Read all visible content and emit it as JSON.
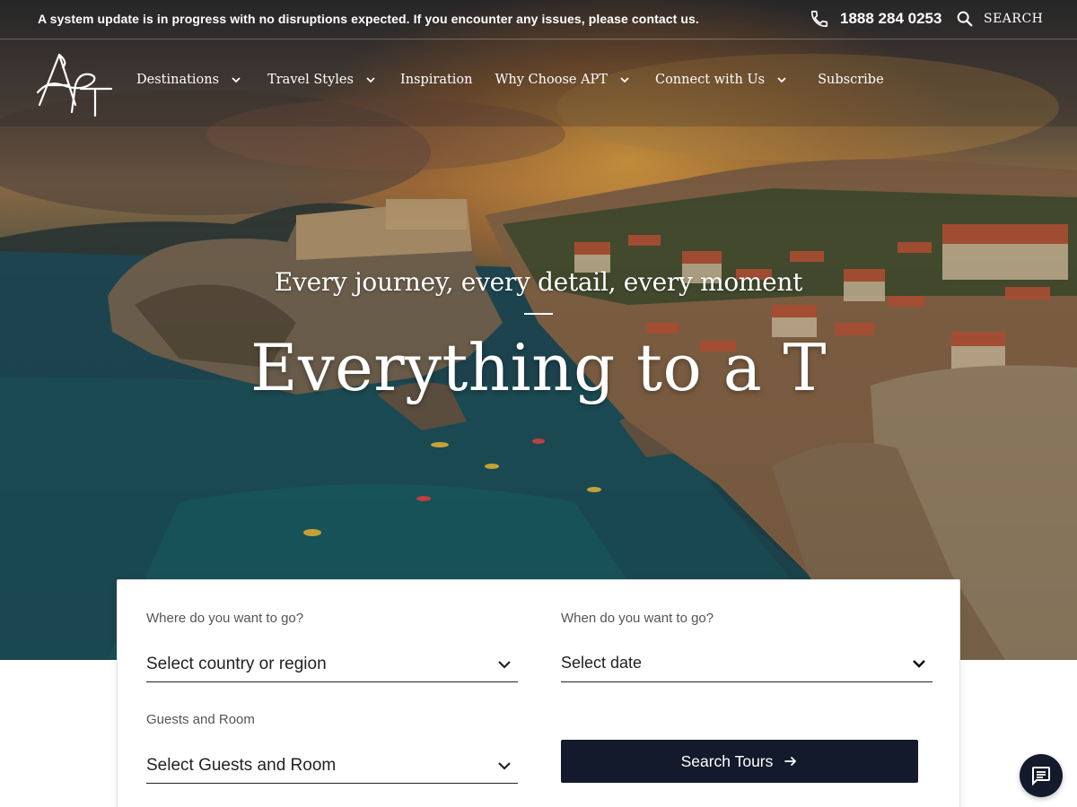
{
  "alert": {
    "text": "A system update is in progress with no disruptions expected. If you encounter any issues, please contact us."
  },
  "header": {
    "phone": "1888 284 0253",
    "search_label": "SEARCH",
    "phone_icon": "phone-icon",
    "search_icon": "search-icon"
  },
  "nav": {
    "logo_text": "APT",
    "items": [
      {
        "label": "Destinations",
        "has_dropdown": true
      },
      {
        "label": "Travel Styles",
        "has_dropdown": true
      },
      {
        "label": "Inspiration",
        "has_dropdown": false
      },
      {
        "label": "Why Choose APT",
        "has_dropdown": true
      },
      {
        "label": "Connect with Us",
        "has_dropdown": true
      },
      {
        "label": "Subscribe",
        "has_dropdown": false
      }
    ]
  },
  "hero": {
    "tagline": "Every journey, every detail, every moment",
    "headline": "Everything to a T"
  },
  "search_form": {
    "destination": {
      "label": "Where do you want to go?",
      "value": "Select country or region"
    },
    "date": {
      "label": "When do you want to go?",
      "value": "Select date"
    },
    "guests": {
      "label": "Guests and Room",
      "value": "Select Guests and Room"
    },
    "submit_label": "Search Tours"
  },
  "chat": {
    "icon": "chat-icon"
  },
  "colors": {
    "brand_navy": "#121a2c",
    "text_dark": "#222222",
    "label_gray": "#555555",
    "white": "#ffffff"
  }
}
